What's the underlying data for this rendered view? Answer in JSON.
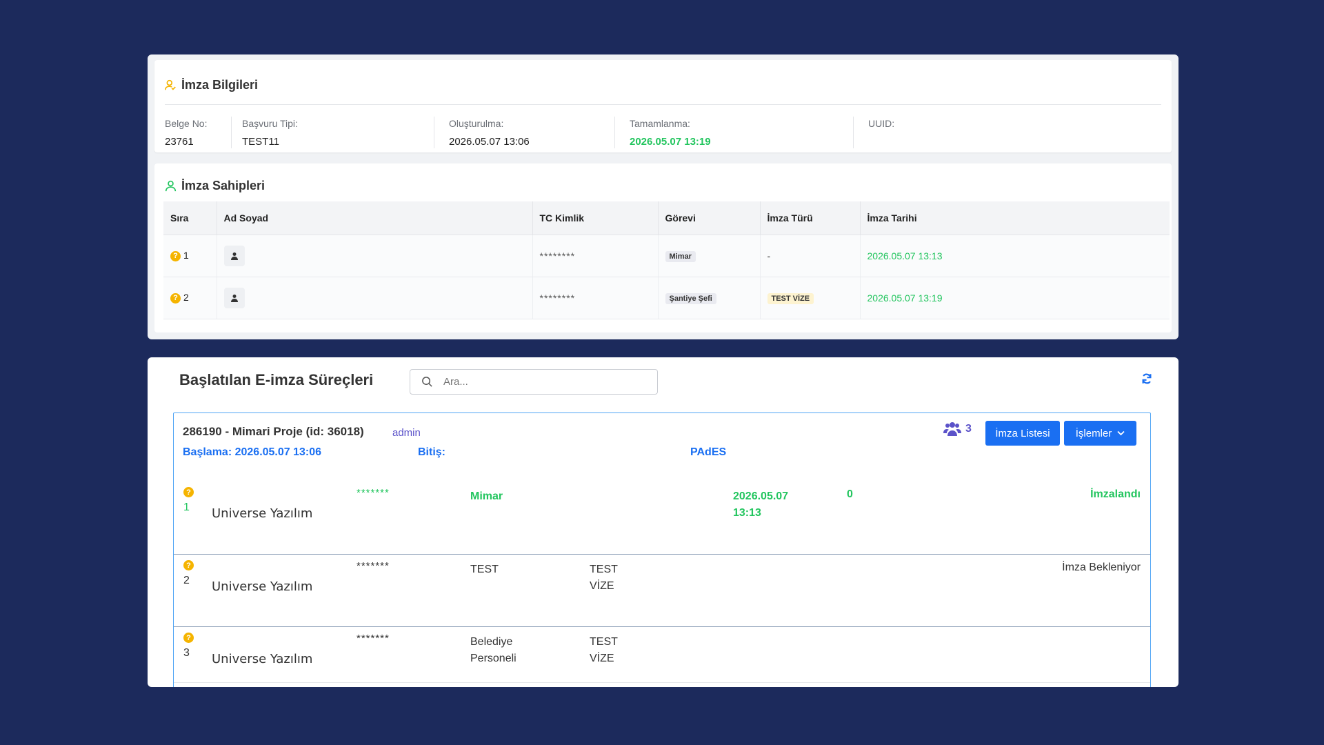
{
  "info": {
    "title": "İmza Bilgileri",
    "fields": [
      {
        "label": "Belge No:",
        "value": "23761"
      },
      {
        "label": "Başvuru Tipi:",
        "value": "TEST11"
      },
      {
        "label": "Oluşturulma:",
        "value": "2026.05.07 13:06"
      },
      {
        "label": "Tamamlanma:",
        "value": "2026.05.07 13:19"
      },
      {
        "label": "UUID:",
        "value": ""
      }
    ]
  },
  "owners": {
    "title": "İmza Sahipleri",
    "columns": [
      "Sıra",
      "Ad Soyad",
      "TC Kimlik",
      "Görevi",
      "İmza Türü",
      "İmza Tarihi"
    ],
    "rows": [
      {
        "index": "1",
        "tc": "********",
        "role": "Mimar",
        "type": "-",
        "date": "2026.05.07 13:13"
      },
      {
        "index": "2",
        "tc": "********",
        "role": "Şantiye Şefi",
        "type": "TEST VİZE",
        "date": "2026.05.07 13:19"
      }
    ]
  },
  "processes": {
    "title": "Başlatılan E-imza Süreçleri",
    "search_placeholder": "Ara...",
    "card": {
      "heading": "286190 - Mimari Proje (id: 36018)",
      "user": "admin",
      "participant_count": "3",
      "btn_list": "İmza Listesi",
      "btn_ops": "İşlemler",
      "start": "Başlama: 2026.05.07 13:06",
      "end": "Bitiş:",
      "format": "PAdES",
      "signers": [
        {
          "index": "1",
          "name": "Universe Yazılım",
          "tc": "*******",
          "role": "Mimar",
          "type": "",
          "date": "2026.05.07 13:13",
          "count": "0",
          "status": "İmzalandı"
        },
        {
          "index": "2",
          "name": "Universe Yazılım",
          "tc": "*******",
          "role": "TEST",
          "type": "TEST VİZE",
          "date": "",
          "count": "",
          "status": "İmza Bekleniyor"
        },
        {
          "index": "3",
          "name": "Universe Yazılım",
          "tc": "*******",
          "role": "Belediye Personeli",
          "type": "TEST VİZE",
          "date": "",
          "count": "",
          "status": ""
        }
      ]
    }
  },
  "colors": {
    "background": "#1c2a5c",
    "accent_blue": "#1a6ff2",
    "success_green": "#22c55e",
    "warning_yellow": "#f5b400",
    "purple": "#5b52c9"
  },
  "icons": [
    "user-sign-icon",
    "user-icon",
    "question-icon",
    "avatar-icon",
    "search-icon",
    "refresh-icon",
    "users-group-icon",
    "chevron-down-icon"
  ]
}
